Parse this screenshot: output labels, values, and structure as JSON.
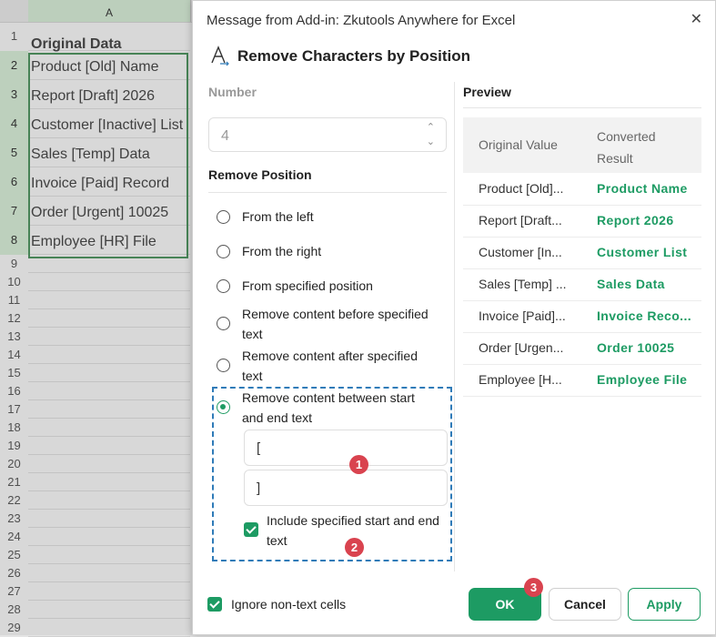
{
  "sheet": {
    "column_header": "A",
    "rows": [
      "1",
      "2",
      "3",
      "4",
      "5",
      "6",
      "7",
      "8",
      "9",
      "10",
      "11",
      "12",
      "13",
      "14",
      "15",
      "16",
      "17",
      "18",
      "19",
      "20",
      "21",
      "22",
      "23",
      "24",
      "25",
      "26",
      "27",
      "28",
      "29"
    ],
    "cells": [
      "Original Data",
      "Product [Old] Name",
      "Report [Draft] 2026",
      "Customer [Inactive] List",
      "Sales [Temp] Data",
      "Invoice [Paid] Record",
      "Order [Urgent] 10025",
      "Employee [HR] File"
    ]
  },
  "dialog": {
    "title": "Message from Add-in: Zkutools Anywhere for Excel",
    "close_glyph": "✕",
    "heading": "Remove Characters by Position",
    "number_label": "Number",
    "number_value": "4",
    "spin_up": "⌃",
    "spin_down": "⌄",
    "remove_position_label": "Remove Position",
    "options": [
      "From the left",
      "From the right",
      "From specified position",
      "Remove content before specified text",
      "Remove content after specified text",
      "Remove content between start and end text"
    ],
    "selected_option": 5,
    "start_text": "[",
    "end_text": "]",
    "include_label": "Include specified start and end text",
    "include_checked": true,
    "badges": [
      "1",
      "2",
      "3"
    ],
    "preview": {
      "label": "Preview",
      "col_original": "Original Value",
      "col_converted": "Converted Result",
      "rows": [
        {
          "original": "Product [Old]...",
          "converted": "Product  Name"
        },
        {
          "original": "Report [Draft...",
          "converted": "Report  2026"
        },
        {
          "original": "Customer [In...",
          "converted": "Customer  List"
        },
        {
          "original": "Sales [Temp] ...",
          "converted": "Sales  Data"
        },
        {
          "original": "Invoice [Paid]...",
          "converted": "Invoice  Reco..."
        },
        {
          "original": "Order [Urgen...",
          "converted": "Order  10025"
        },
        {
          "original": "Employee [H...",
          "converted": "Employee  File"
        }
      ]
    },
    "ignore_label": "Ignore non-text cells",
    "ignore_checked": true,
    "ok_label": "OK",
    "cancel_label": "Cancel",
    "apply_label": "Apply"
  },
  "colors": {
    "accent": "#1d9b63",
    "badge": "#d9434f",
    "dashed_border": "#2f7bb8"
  }
}
